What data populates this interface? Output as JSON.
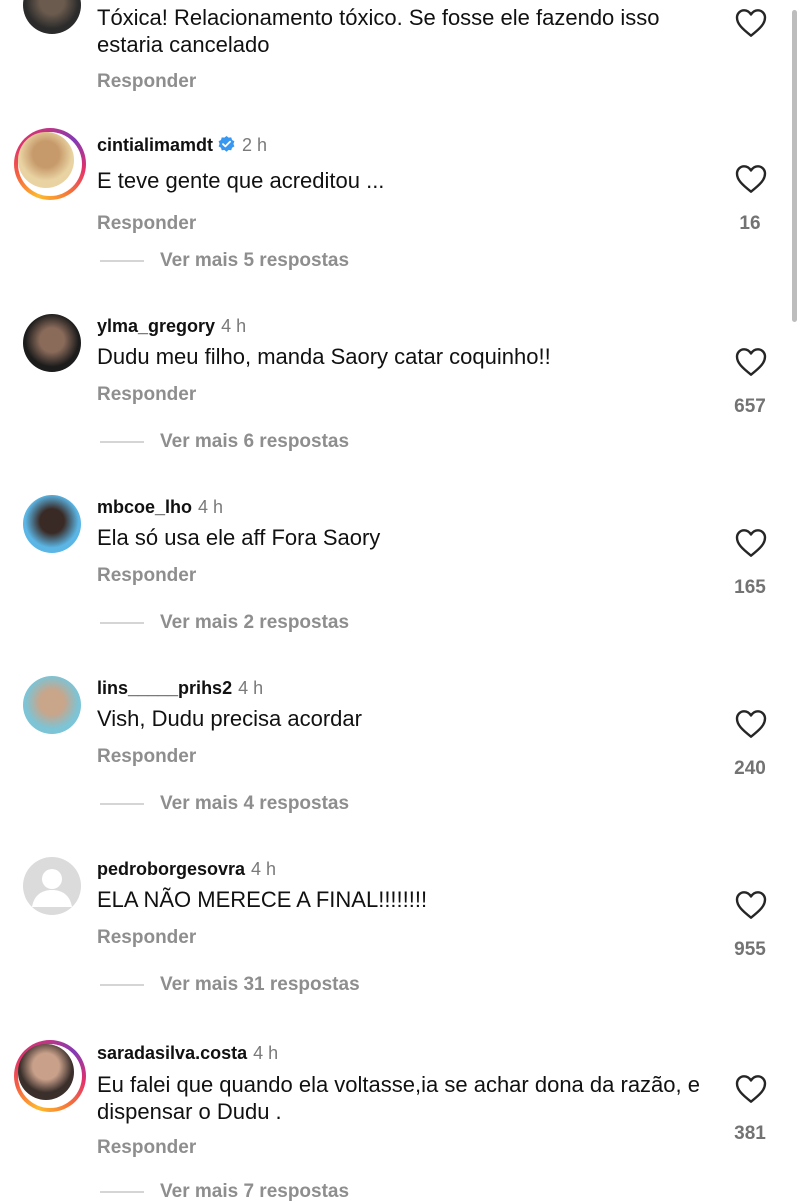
{
  "comments": [
    {
      "username": "",
      "time": "",
      "verified": false,
      "text": "Tóxica! Relacionamento tóxico. Se fosse ele fazendo isso estaria cancelado",
      "reply": "Responder",
      "likes": "",
      "more": "",
      "ring": false,
      "colors": [
        "#2b2b2b",
        "#6b5b4e"
      ]
    },
    {
      "username": "cintialimamdt",
      "time": "2 h",
      "verified": true,
      "text": "E teve gente que acreditou ...",
      "reply": "Responder",
      "likes": "16",
      "more": "Ver mais 5 respostas",
      "ring": true,
      "colors": [
        "#e9d3a2",
        "#c79a6b"
      ]
    },
    {
      "username": "ylma_gregory",
      "time": "4 h",
      "verified": false,
      "text": "Dudu meu filho, manda Saory catar coquinho!!",
      "reply": "Responder",
      "likes": "657",
      "more": "Ver mais 6 respostas",
      "ring": false,
      "colors": [
        "#1c1c1c",
        "#8a6b5a"
      ]
    },
    {
      "username": "mbcoe_lho",
      "time": "4 h",
      "verified": false,
      "text": "Ela só usa ele aff Fora Saory",
      "reply": "Responder",
      "likes": "165",
      "more": "Ver mais 2 respostas",
      "ring": false,
      "colors": [
        "#5bb6e6",
        "#3a2a25"
      ]
    },
    {
      "username": "lins_____prihs2",
      "time": "4 h",
      "verified": false,
      "text": "Vish, Dudu  precisa acordar",
      "reply": "Responder",
      "likes": "240",
      "more": "Ver mais 4 respostas",
      "ring": false,
      "colors": [
        "#7cc4d6",
        "#c9a58a"
      ]
    },
    {
      "username": "pedroborgesovra",
      "time": "4 h",
      "verified": false,
      "text": "ELA NÃO MERECE A FINAL!!!!!!!!",
      "reply": "Responder",
      "likes": "955",
      "more": "Ver mais 31 respostas",
      "ring": false,
      "colors": [
        "#dcdcdc",
        "#dcdcdc"
      ],
      "default_avatar": true
    },
    {
      "username": "saradasilva.costa",
      "time": "4 h",
      "verified": false,
      "text": "Eu falei que quando ela voltasse,ia se achar dona da razão, e dispensar o Dudu .",
      "reply": "Responder",
      "likes": "381",
      "more": "Ver mais 7 respostas",
      "ring": true,
      "colors": [
        "#3a2f2b",
        "#c9a08a"
      ]
    }
  ]
}
